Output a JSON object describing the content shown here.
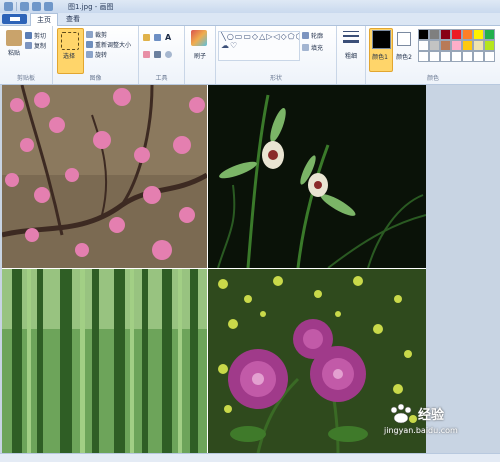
{
  "window": {
    "title": "图1.jpg - 画图"
  },
  "tabs": [
    {
      "label": "主页"
    },
    {
      "label": "查看"
    }
  ],
  "ribbon": {
    "clipboard": {
      "paste": "粘贴",
      "cut": "剪切",
      "copy": "复制",
      "label": "剪贴板"
    },
    "image": {
      "select": "选择",
      "crop": "裁剪",
      "resize": "重新调整大小",
      "rotate": "旋转",
      "label": "图像"
    },
    "tools": {
      "text_tool": "A",
      "label": "工具"
    },
    "brushes": {
      "label": "刷子"
    },
    "shapes": {
      "glyphs": "╲○▭▭◇△▷◁◇⬠⬡▢☆☆☆◯☁♡",
      "outline": "轮廓",
      "fill": "填充",
      "label": "形状"
    },
    "size": {
      "label": "粗细"
    },
    "colors": {
      "color1": "颜色1",
      "color2": "颜色2",
      "label": "颜色",
      "color1_value": "#000000",
      "color2_value": "#ffffff",
      "palette_row1": [
        "#000000",
        "#7f7f7f",
        "#880015",
        "#ed1c24",
        "#ff7f27",
        "#fff200",
        "#22b14c"
      ],
      "palette_row2": [
        "#ffffff",
        "#c3c3c3",
        "#b97a57",
        "#ffaec9",
        "#ffc90e",
        "#efe4b0",
        "#b5e61d"
      ],
      "palette_row3": [
        "#ffffff",
        "#ffffff",
        "#ffffff",
        "#ffffff",
        "#ffffff",
        "#ffffff",
        "#ffffff"
      ]
    }
  },
  "watermark": {
    "main": "经验",
    "url": "jingyan.baidu.com"
  }
}
